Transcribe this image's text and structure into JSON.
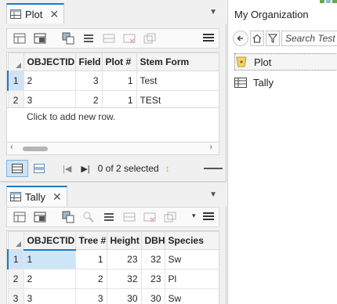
{
  "plot_view": {
    "tab_label": "Plot",
    "columns": [
      "OBJECTID *",
      "Field",
      "Plot #",
      "Stem Form"
    ],
    "rows": [
      {
        "row_num": "1",
        "objectid": "2",
        "field": "3",
        "plot": "1",
        "stem_form": "Test"
      },
      {
        "row_num": "2",
        "objectid": "3",
        "field": "2",
        "plot": "1",
        "stem_form": "TESt"
      }
    ],
    "add_row_text": "Click to add new row.",
    "selection_status": "0 of 2 selected"
  },
  "tally_view": {
    "tab_label": "Tally",
    "columns": [
      "OBJECTID *",
      "Tree #",
      "Height",
      "DBH",
      "Species"
    ],
    "rows": [
      {
        "row_num": "1",
        "objectid": "1",
        "tree": "1",
        "height": "23",
        "dbh": "32",
        "species": "Sw"
      },
      {
        "row_num": "2",
        "objectid": "2",
        "tree": "2",
        "height": "32",
        "dbh": "23",
        "species": "Pl"
      },
      {
        "row_num": "3",
        "objectid": "3",
        "tree": "3",
        "height": "30",
        "dbh": "30",
        "species": "Sw"
      }
    ]
  },
  "catalog": {
    "heading": "My Organization",
    "search_placeholder": "Search Test",
    "items": [
      {
        "label": "Plot",
        "icon": "feature-layer-icon",
        "selected": true
      },
      {
        "label": "Tally",
        "icon": "table-icon",
        "selected": false
      }
    ]
  },
  "colors": {
    "accent": "#1f7bc1",
    "selected_cell": "#cde6f7"
  }
}
